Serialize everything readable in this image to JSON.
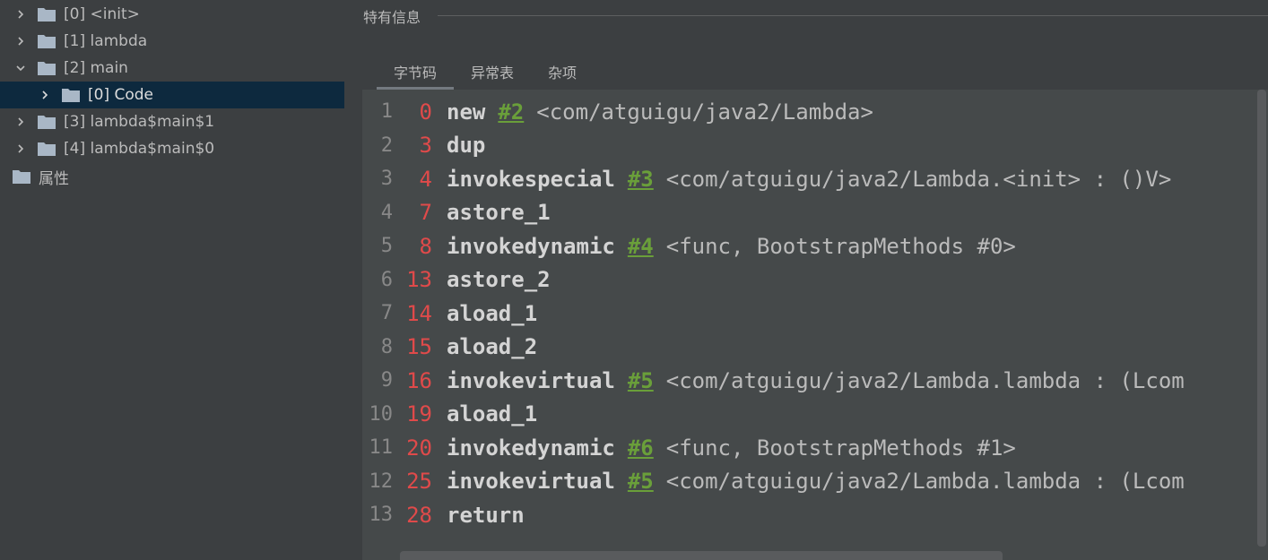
{
  "tree": {
    "items": [
      {
        "label": "[0] <init>",
        "expanded": false,
        "selected": false
      },
      {
        "label": "[1] lambda",
        "expanded": false,
        "selected": false
      },
      {
        "label": "[2] main",
        "expanded": true,
        "selected": false
      },
      {
        "label": "[0] Code",
        "expanded": false,
        "selected": true
      },
      {
        "label": "[3] lambda$main$1",
        "expanded": false,
        "selected": false
      },
      {
        "label": "[4] lambda$main$0",
        "expanded": false,
        "selected": false
      },
      {
        "label": "属性",
        "expanded": false,
        "selected": false
      }
    ]
  },
  "panel": {
    "section_title": "特有信息",
    "tabs": [
      {
        "label": "字节码",
        "active": true
      },
      {
        "label": "异常表",
        "active": false
      },
      {
        "label": "杂项",
        "active": false
      }
    ]
  },
  "code": {
    "lines": [
      {
        "line": "1",
        "offset": "0",
        "op": "new",
        "ref": "#2",
        "arg": "<com/atguigu/java2/Lambda>"
      },
      {
        "line": "2",
        "offset": "3",
        "op": "dup",
        "ref": "",
        "arg": ""
      },
      {
        "line": "3",
        "offset": "4",
        "op": "invokespecial",
        "ref": "#3",
        "arg": "<com/atguigu/java2/Lambda.<init> : ()V>"
      },
      {
        "line": "4",
        "offset": "7",
        "op": "astore_1",
        "ref": "",
        "arg": ""
      },
      {
        "line": "5",
        "offset": "8",
        "op": "invokedynamic",
        "ref": "#4",
        "arg": "<func, BootstrapMethods #0>"
      },
      {
        "line": "6",
        "offset": "13",
        "op": "astore_2",
        "ref": "",
        "arg": ""
      },
      {
        "line": "7",
        "offset": "14",
        "op": "aload_1",
        "ref": "",
        "arg": ""
      },
      {
        "line": "8",
        "offset": "15",
        "op": "aload_2",
        "ref": "",
        "arg": ""
      },
      {
        "line": "9",
        "offset": "16",
        "op": "invokevirtual",
        "ref": "#5",
        "arg": "<com/atguigu/java2/Lambda.lambda : (Lcom"
      },
      {
        "line": "10",
        "offset": "19",
        "op": "aload_1",
        "ref": "",
        "arg": ""
      },
      {
        "line": "11",
        "offset": "20",
        "op": "invokedynamic",
        "ref": "#6",
        "arg": "<func, BootstrapMethods #1>"
      },
      {
        "line": "12",
        "offset": "25",
        "op": "invokevirtual",
        "ref": "#5",
        "arg": "<com/atguigu/java2/Lambda.lambda : (Lcom"
      },
      {
        "line": "13",
        "offset": "28",
        "op": "return",
        "ref": "",
        "arg": ""
      }
    ]
  },
  "colors": {
    "background": "#3c3f41",
    "editor_background": "#45494a",
    "selection": "#0d293e",
    "offset": "#e04a4a",
    "ref": "#6a9f3a",
    "folder": "#a9b7c6"
  }
}
